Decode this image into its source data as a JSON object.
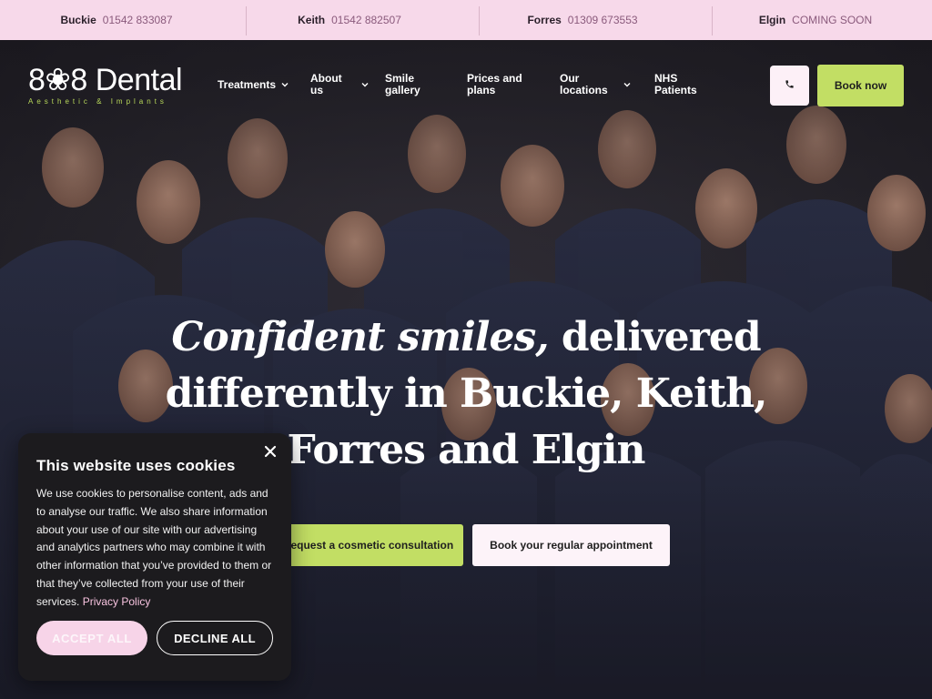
{
  "topbar": {
    "locations": [
      {
        "town": "Buckie",
        "phone": "01542 833087"
      },
      {
        "town": "Keith",
        "phone": "01542 882507"
      },
      {
        "town": "Forres",
        "phone": "01309 673553"
      },
      {
        "town": "Elgin",
        "phone": "COMING SOON"
      }
    ]
  },
  "brand": {
    "name": "8❀8 Dental",
    "tagline": "Aesthetic & Implants"
  },
  "nav": {
    "items": [
      {
        "label": "Treatments",
        "has_dropdown": true
      },
      {
        "label": "About us",
        "has_dropdown": true
      },
      {
        "label": "Smile gallery",
        "has_dropdown": false
      },
      {
        "label": "Prices and plans",
        "has_dropdown": false
      },
      {
        "label": "Our locations",
        "has_dropdown": true
      },
      {
        "label": "NHS Patients",
        "has_dropdown": false
      }
    ],
    "call_icon": "phone-icon",
    "book_label": "Book now"
  },
  "hero": {
    "headline_em": "Confident smiles,",
    "headline_rest": "delivered differently in Buckie, Keith, Forres and Elgin",
    "cta_primary": "Request a cosmetic consultation",
    "cta_secondary": "Book your regular appointment"
  },
  "cookie": {
    "title": "This website uses cookies",
    "body": "We use cookies to personalise content, ads and to analyse our traffic. We also share information about your use of our site with our advertising and analytics partners who may combine it with other information that you’ve provided to them or that they’ve collected from your use of their services.",
    "policy_link": "Privacy Policy",
    "accept": "ACCEPT ALL",
    "decline": "DECLINE ALL"
  },
  "colors": {
    "topbar_bg": "#f7d9ea",
    "accent_green": "#c2de64",
    "pink_soft": "#f7d4e8",
    "scrub_navy": "#2a2f45"
  }
}
